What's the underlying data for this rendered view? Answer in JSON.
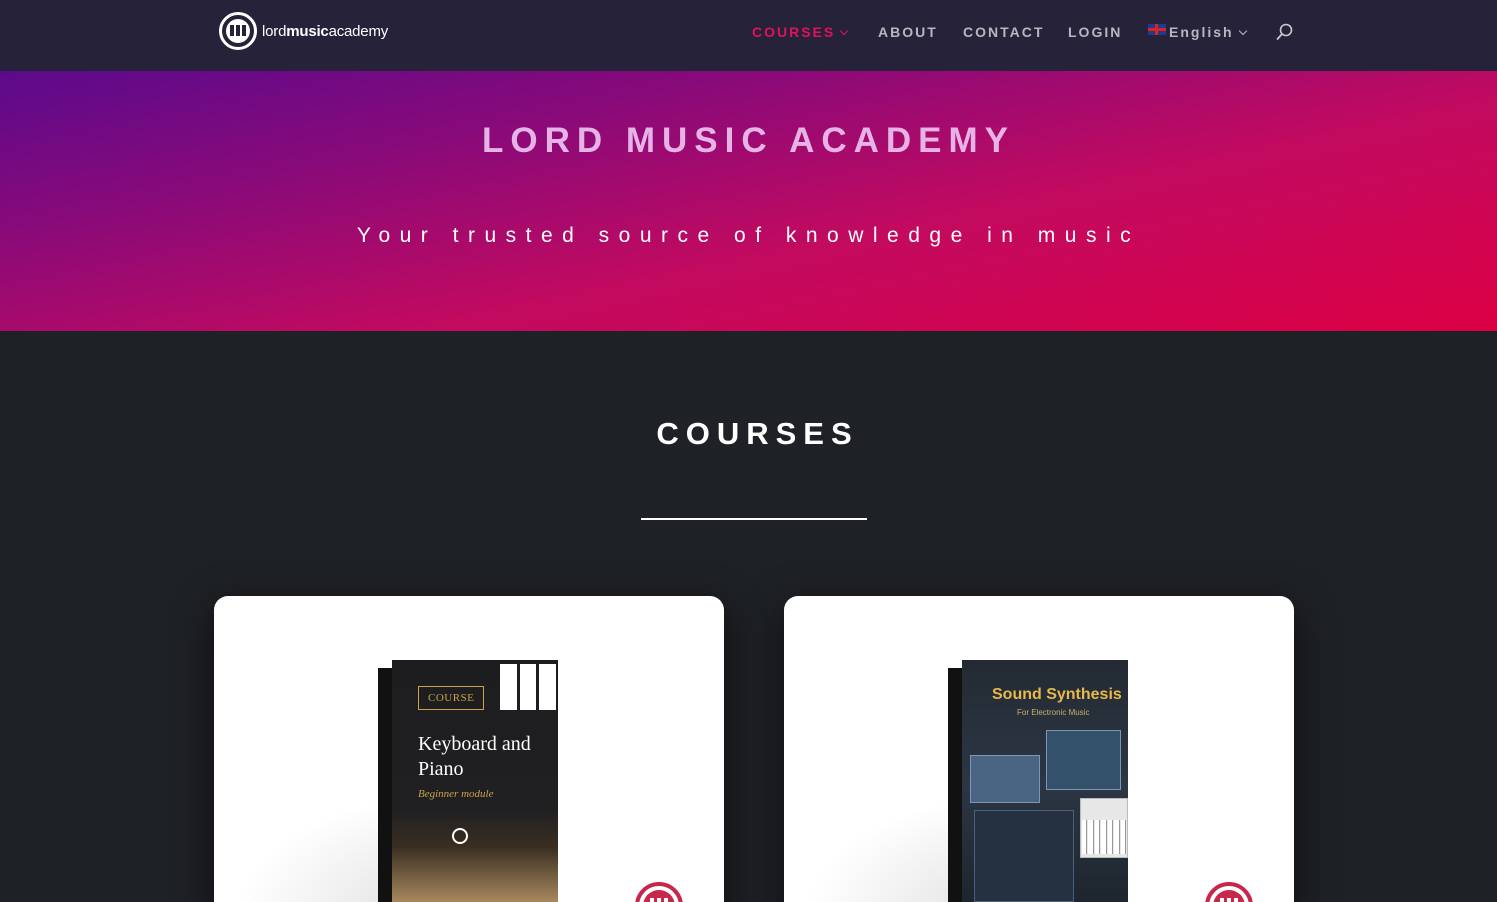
{
  "header": {
    "logo": {
      "text_light_1": "lord",
      "text_bold": "music",
      "text_light_2": "academy"
    },
    "nav": [
      {
        "label": "COURSES",
        "active": true,
        "has_dropdown": true
      },
      {
        "label": "ABOUT"
      },
      {
        "label": "CONTACT"
      },
      {
        "label": "LOGIN"
      },
      {
        "label": "English",
        "has_dropdown": true,
        "icon": "uk-flag-icon"
      }
    ],
    "search_icon": "search-icon"
  },
  "hero": {
    "title": "LORD MUSIC ACADEMY",
    "subtitle": "Your trusted source of knowledge in music"
  },
  "courses": {
    "heading": "COURSES",
    "cards": [
      {
        "tag": "COURSE",
        "title": "Keyboard and Piano",
        "subtitle": "Beginner module"
      },
      {
        "title": "Sound Synthesis",
        "subtitle": "For Electronic Music"
      }
    ]
  },
  "colors": {
    "header_bg": "#26223a",
    "accent": "#e0115f",
    "page_bg": "#1e2125",
    "badge": "#c7274a",
    "gold": "#c9a24a"
  }
}
